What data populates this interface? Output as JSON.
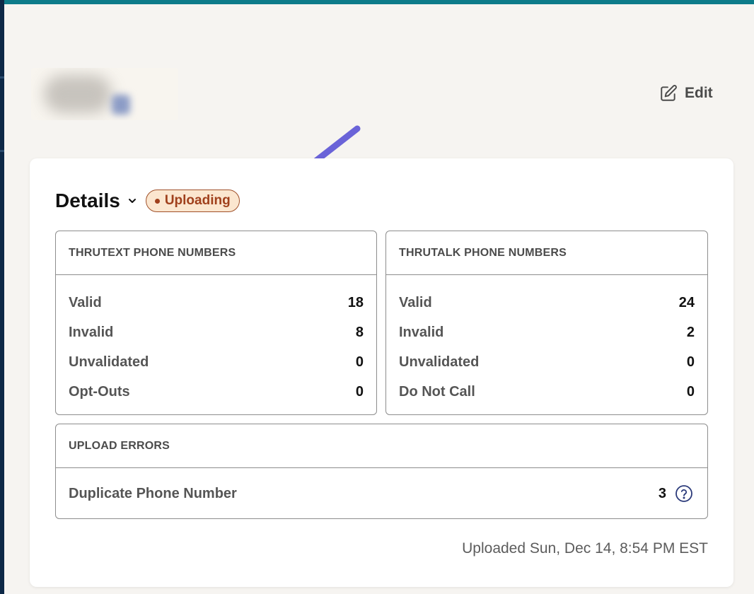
{
  "header": {
    "edit_label": "Edit"
  },
  "details": {
    "title": "Details",
    "status_badge": "Uploading"
  },
  "thrutext": {
    "title": "THRUTEXT PHONE NUMBERS",
    "rows": [
      {
        "label": "Valid",
        "value": "18"
      },
      {
        "label": "Invalid",
        "value": "8"
      },
      {
        "label": "Unvalidated",
        "value": "0"
      },
      {
        "label": "Opt-Outs",
        "value": "0"
      }
    ]
  },
  "thrutalk": {
    "title": "THRUTALK PHONE NUMBERS",
    "rows": [
      {
        "label": "Valid",
        "value": "24"
      },
      {
        "label": "Invalid",
        "value": "2"
      },
      {
        "label": "Unvalidated",
        "value": "0"
      },
      {
        "label": "Do Not Call",
        "value": "0"
      }
    ]
  },
  "upload_errors": {
    "title": "UPLOAD ERRORS",
    "rows": [
      {
        "label": "Duplicate Phone Number",
        "value": "3"
      }
    ]
  },
  "footer": {
    "uploaded_text": "Uploaded Sun, Dec 14, 8:54 PM EST"
  },
  "colors": {
    "accent_teal": "#0d7b8a",
    "badge_bg": "#fbe6cf",
    "badge_text": "#a0401c",
    "annotation_arrow": "#6a63d8",
    "help_icon": "#2b3a7a"
  },
  "icons": {
    "edit": "pencil-square-icon",
    "expand": "chevron-down-icon",
    "status": "dot-icon",
    "help": "question-circle-icon"
  }
}
